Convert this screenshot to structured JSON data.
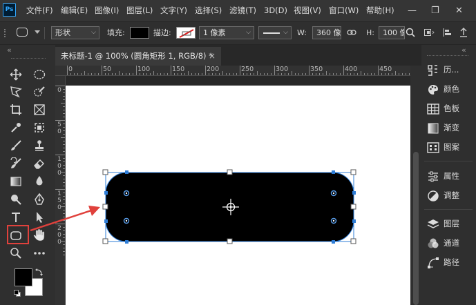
{
  "app": {
    "logo_text": "Ps"
  },
  "menu": {
    "items": [
      "文件(F)",
      "编辑(E)",
      "图像(I)",
      "图层(L)",
      "文字(Y)",
      "选择(S)",
      "滤镜(T)",
      "3D(D)",
      "视图(V)",
      "窗口(W)",
      "帮助(H)"
    ]
  },
  "window_controls": {
    "minimize": "—",
    "restore": "❐",
    "close": "✕"
  },
  "options_bar": {
    "mode_value": "形状",
    "fill_label": "填充:",
    "stroke_label": "描边:",
    "stroke_width_value": "1 像素",
    "width_label": "W:",
    "width_value": "360 像",
    "height_label": "H:",
    "height_value": "100 像",
    "link_icon": "link-icon",
    "fill_color": "#000000"
  },
  "document_tab": {
    "title": "未标题-1 @ 100% (圆角矩形 1, RGB/8) *",
    "close": "×"
  },
  "ruler": {
    "h_labels": [
      "0",
      "50",
      "100",
      "150",
      "200",
      "250",
      "300",
      "350",
      "400",
      "450"
    ],
    "v_labels": [
      [
        "0"
      ],
      [
        "5",
        "0"
      ],
      [
        "1",
        "0",
        "0"
      ],
      [
        "1",
        "5",
        "0"
      ],
      [
        "2",
        "0",
        "0"
      ]
    ]
  },
  "panels": {
    "collapse_arrows": "«",
    "items": [
      {
        "label": "历...",
        "icon": "history-icon"
      },
      {
        "label": "颜色",
        "icon": "color-palette-icon"
      },
      {
        "label": "色板",
        "icon": "swatches-icon"
      },
      {
        "label": "渐变",
        "icon": "gradient-icon"
      },
      {
        "label": "图案",
        "icon": "patterns-icon"
      },
      {
        "label": "属性",
        "icon": "properties-sliders-icon"
      },
      {
        "label": "调整",
        "icon": "adjustments-icon"
      },
      {
        "label": "图层",
        "icon": "layers-icon"
      },
      {
        "label": "通道",
        "icon": "channels-icon"
      },
      {
        "label": "路径",
        "icon": "paths-icon"
      }
    ]
  },
  "colors": {
    "foreground": "#000000",
    "background": "#ffffff",
    "selection_handle": "#2e7dd7",
    "annotation_red": "#e0413c"
  }
}
